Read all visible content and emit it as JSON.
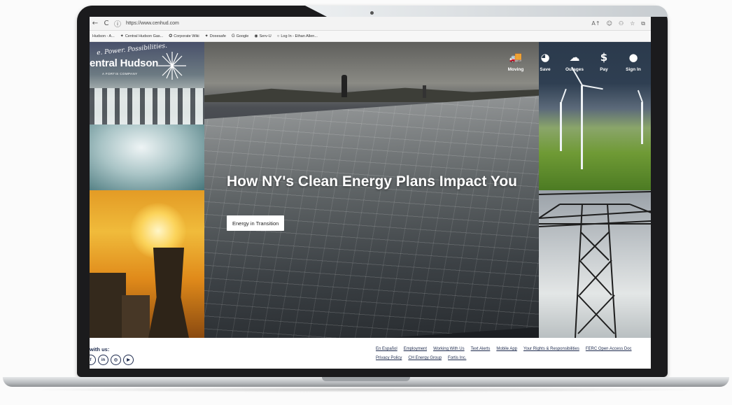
{
  "browser": {
    "back_glyph": "←",
    "refresh_glyph": "C",
    "info_glyph": "ⓘ",
    "url": "https://www.cenhud.com",
    "toolbar_icons": [
      "A↑",
      "☺",
      "⚇",
      "☆",
      "⧉"
    ]
  },
  "bookmarks": [
    {
      "icon": "",
      "label": "Hudson - A..."
    },
    {
      "icon": "✦",
      "label": "Central Hudson Gas..."
    },
    {
      "icon": "✪",
      "label": "Corporate Wiki"
    },
    {
      "icon": "✦",
      "label": "Doxesafe"
    },
    {
      "icon": "G",
      "label": "Google"
    },
    {
      "icon": "◉",
      "label": "Serv-U"
    },
    {
      "icon": "○",
      "label": "Log In - Ethan Allen..."
    }
  ],
  "logo": {
    "tagline": "e. Power. Possibilities.",
    "name": "entral Hudson",
    "sub": "A FORTIS COMPANY"
  },
  "nav": [
    {
      "icon": "🚚",
      "label": "Moving",
      "icon_name": "truck-icon"
    },
    {
      "icon": "◕",
      "label": "Save",
      "icon_name": "piggy-bank-icon"
    },
    {
      "icon": "☁",
      "label": "Outages",
      "icon_name": "cloud-icon"
    },
    {
      "icon": "$",
      "label": "Pay",
      "icon_name": "dollar-icon"
    },
    {
      "icon": "●",
      "label": "Sign In",
      "icon_name": "user-icon"
    }
  ],
  "hero": {
    "headline": "How NY's Clean Energy Plans Impact You",
    "cta_label": "Energy in Transition"
  },
  "footer": {
    "follow_label": "with us:",
    "social": [
      "f",
      "in",
      "◎",
      "▶"
    ],
    "links_row1": [
      "En Español",
      "Employment",
      "Working With Us",
      "Text Alerts",
      "Mobile App",
      "Your Rights & Responsibilities",
      "FERC Open Access Doc"
    ],
    "links_row2": [
      "Privacy Policy",
      "CH Energy Group",
      "Fortis Inc."
    ]
  },
  "colors": {
    "footer_link": "#1e2b4e",
    "laptop_frame": "#1b1b1d"
  }
}
